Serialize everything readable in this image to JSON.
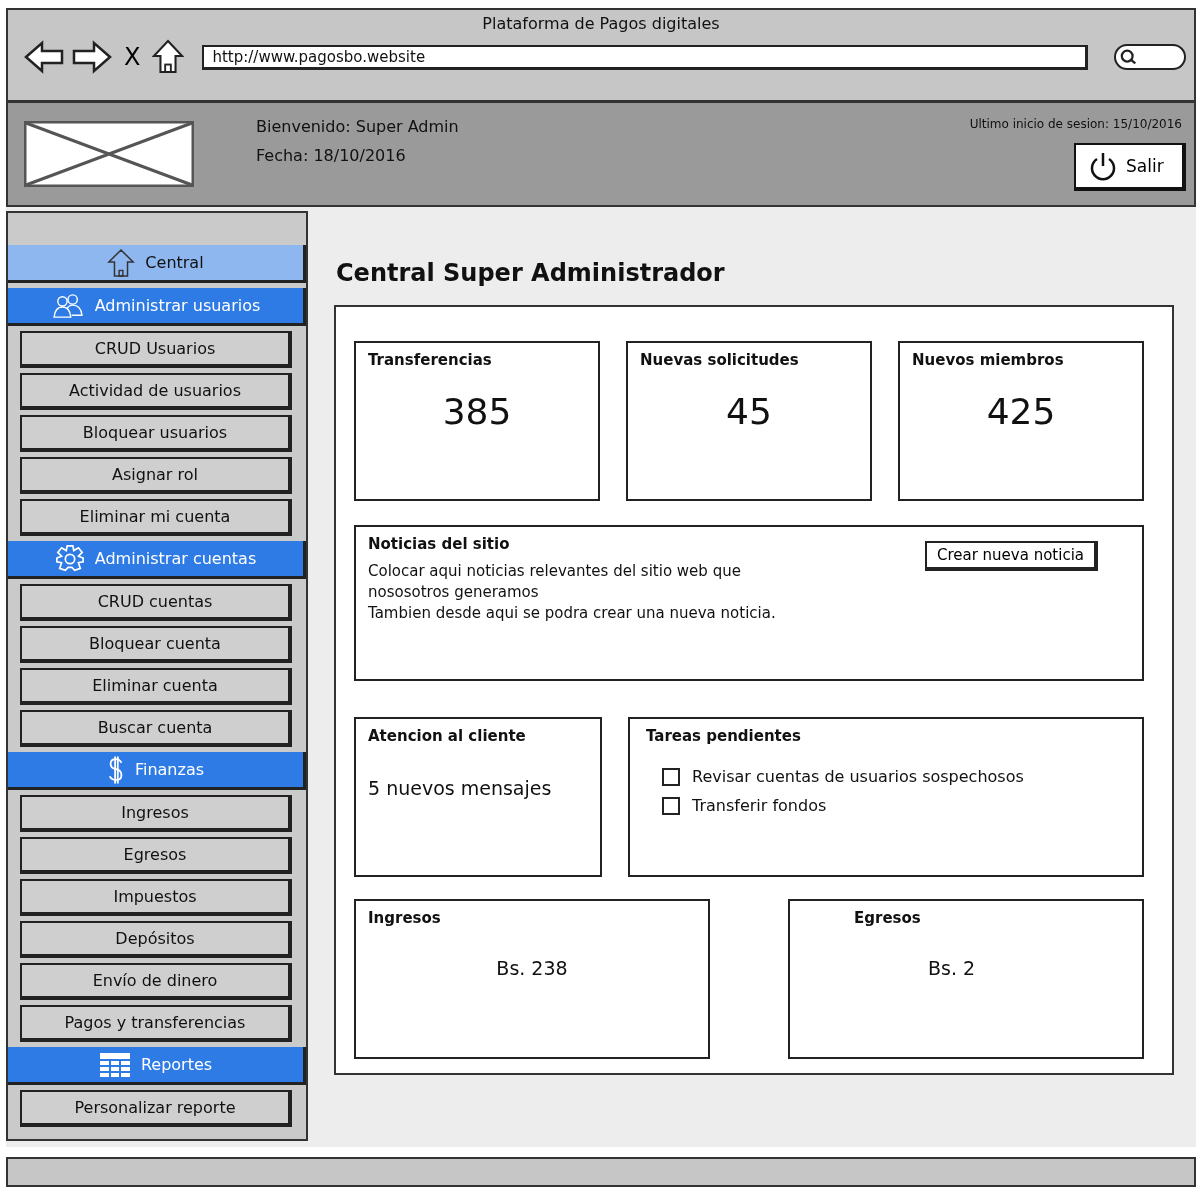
{
  "window": {
    "title": "Plataforma de Pagos digitales"
  },
  "browser": {
    "url": "http://www.pagosbo.website",
    "stop_label": "X"
  },
  "header": {
    "welcome": "Bienvenido: Super Admin",
    "date": "Fecha: 18/10/2016",
    "last_login": "Ultimo inicio de sesion: 15/10/2016",
    "logout_label": "Salir"
  },
  "sidebar": {
    "sections": [
      {
        "label": "Central",
        "selected": true
      },
      {
        "label": "Administrar usuarios",
        "selected": false,
        "items": [
          "CRUD Usuarios",
          "Actividad de usuarios",
          "Bloquear usuarios",
          "Asignar rol",
          "Eliminar mi cuenta"
        ]
      },
      {
        "label": "Administrar cuentas",
        "selected": false,
        "items": [
          "CRUD cuentas",
          "Bloquear cuenta",
          "Eliminar cuenta",
          "Buscar cuenta"
        ]
      },
      {
        "label": "Finanzas",
        "selected": false,
        "items": [
          "Ingresos",
          "Egresos",
          "Impuestos",
          "Depósitos",
          "Envío de dinero",
          "Pagos y transferencias"
        ]
      },
      {
        "label": "Reportes",
        "selected": false,
        "items": [
          "Personalizar reporte"
        ]
      }
    ]
  },
  "page_title": "Central Super Administrador",
  "stats": [
    {
      "title": "Transferencias",
      "value": "385"
    },
    {
      "title": "Nuevas solicitudes",
      "value": "45"
    },
    {
      "title": "Nuevos miembros",
      "value": "425"
    }
  ],
  "news": {
    "title": "Noticias del sitio",
    "lines": [
      "Colocar aqui noticias relevantes del sitio web que",
      "nososotros generamos",
      "Tambien desde aqui se podra crear una nueva noticia."
    ],
    "button": "Crear nueva noticia"
  },
  "support": {
    "title": "Atencion al cliente",
    "message": "5 nuevos mensajes"
  },
  "tasks": {
    "title": "Tareas pendientes",
    "items": [
      {
        "label": "Revisar cuentas de usuarios sospechosos",
        "checked": false
      },
      {
        "label": "Transferir fondos",
        "checked": false
      }
    ]
  },
  "money": [
    {
      "title": "Ingresos",
      "value": "Bs. 238"
    },
    {
      "title": "Egresos",
      "value": "Bs. 2"
    }
  ]
}
